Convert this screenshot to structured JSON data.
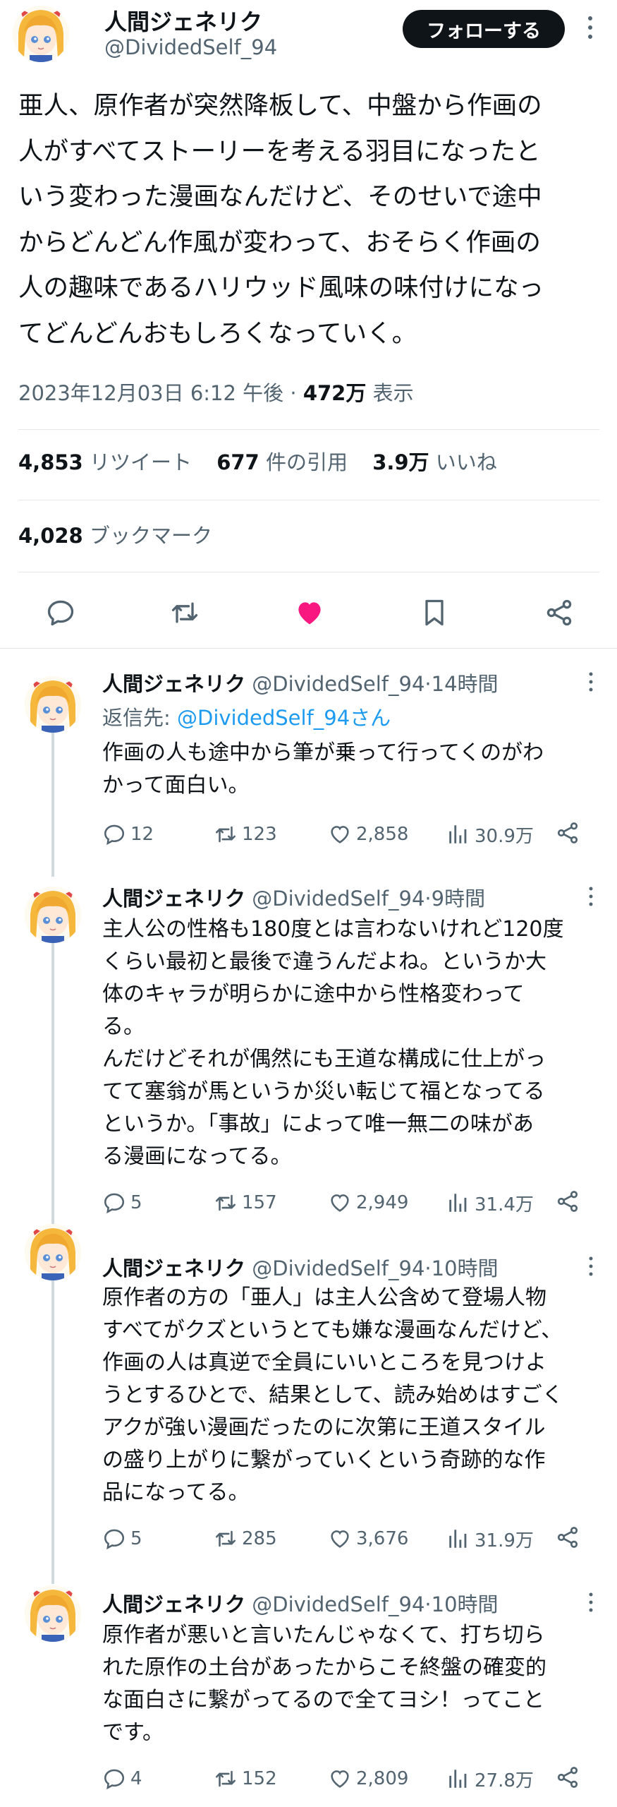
{
  "main_tweet": {
    "author_name": "人間ジェネリク",
    "author_handle": "@DividedSelf_94",
    "follow_label": "フォローする",
    "text": "亜人、原作者が突然降板して、中盤から作画の\n人がすべてストーリーを考える羽目になったと\nいう変わった漫画なんだけど、そのせいで途中\nからどんどん作風が変わって、おそらく作画の\n人の趣味であるハリウッド風味の味付けになっ\nてどんどんおもしろくなっていく。",
    "timestamp": "2023年12月03日 6:12 午後",
    "separator": "·",
    "views": "472万",
    "views_label": "表示",
    "retweets": "4,853",
    "retweets_label": "リツイート",
    "quotes": "677",
    "quotes_label": "件の引用",
    "likes": "3.9万",
    "likes_label": "いいね",
    "bookmarks": "4,028",
    "bookmarks_label": "ブックマーク"
  },
  "colors": {
    "like_active": "#f91880",
    "link": "#1d9bf0",
    "secondary_text": "#536471",
    "primary_text": "#0f1419"
  },
  "action_icons": [
    "reply-icon",
    "retweet-icon",
    "like-icon",
    "bookmark-icon",
    "share-icon"
  ],
  "replies": [
    {
      "name": "人間ジェネリク",
      "handle": "@DividedSelf_94",
      "dot": "·",
      "time": "14時間",
      "reply_to_prefix": "返信先: ",
      "reply_to_handle": "@DividedSelf_94さん",
      "text": "作画の人も途中から筆が乗って行ってくのがわ\nかって面白い。",
      "replies": "12",
      "retweets": "123",
      "likes": "2,858",
      "views": "30.9万"
    },
    {
      "name": "人間ジェネリク",
      "handle": "@DividedSelf_94",
      "dot": "·",
      "time": "9時間",
      "text": "主人公の性格も180度とは言わないけれど120度\nくらい最初と最後で違うんだよね。というか大\n体のキャラが明らかに途中から性格変わって\nる。\nんだけどそれが偶然にも王道な構成に仕上がっ\nてて塞翁が馬というか災い転じて福となってる\nというか。「事故」によって唯一無二の味があ\nる漫画になってる。",
      "replies": "5",
      "retweets": "157",
      "likes": "2,949",
      "views": "31.4万"
    },
    {
      "name": "人間ジェネリク",
      "handle": "@DividedSelf_94",
      "dot": "·",
      "time": "10時間",
      "text": "原作者の方の「亜人」は主人公含めて登場人物\nすべてがクズというとても嫌な漫画なんだけど、\n作画の人は真逆で全員にいいところを見つけよ\nうとするひとで、結果として、読み始めはすごく\nアクが強い漫画だったのに次第に王道スタイル\nの盛り上がりに繋がっていくという奇跡的な作\n品になってる。",
      "replies": "5",
      "retweets": "285",
      "likes": "3,676",
      "views": "31.9万"
    },
    {
      "name": "人間ジェネリク",
      "handle": "@DividedSelf_94",
      "dot": "·",
      "time": "10時間",
      "text": "原作者が悪いと言いたんじゃなくて、打ち切ら\nれた原作の土台があったからこそ終盤の確変的\nな面白さに繋がってるので全てヨシ！ってこと\nです。",
      "replies": "4",
      "retweets": "152",
      "likes": "2,809",
      "views": "27.8万"
    }
  ]
}
